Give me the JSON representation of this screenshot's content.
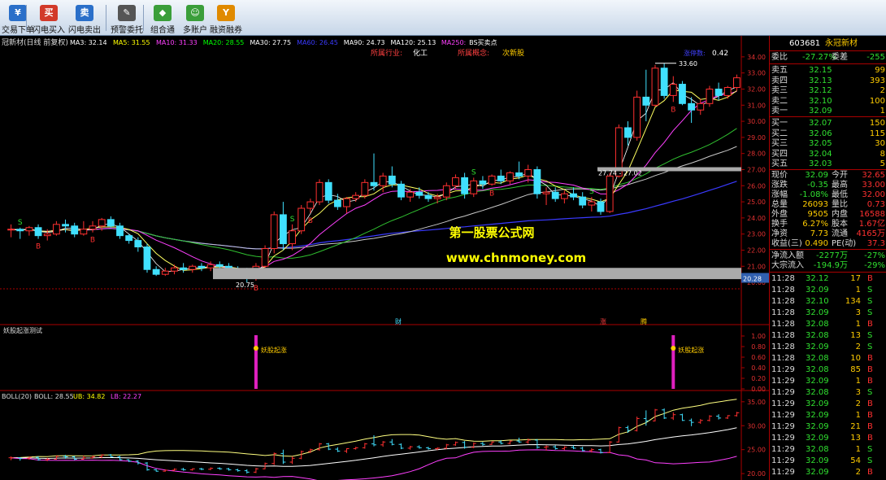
{
  "toolbar": {
    "items": [
      {
        "label": "交易下单",
        "glyph": "¥",
        "color": "#2a6fc9"
      },
      {
        "label": "闪电买入",
        "glyph": "买",
        "color": "#d23a2a"
      },
      {
        "label": "闪电卖出",
        "glyph": "卖",
        "color": "#2a6fc9"
      },
      {
        "label": "预警委托",
        "glyph": "✎",
        "color": "#555"
      },
      {
        "label": "组合通",
        "glyph": "◆",
        "color": "#3a9e3a"
      },
      {
        "label": "多账户",
        "glyph": "☺",
        "color": "#3a9e3a"
      },
      {
        "label": "融资融券",
        "glyph": "Y",
        "color": "#e08a00"
      }
    ]
  },
  "chart_data": {
    "type": "candlestick",
    "header": {
      "title": "冠新材(日线 前复权)",
      "indicators": [
        {
          "label": "MA3: 32.14",
          "color": "#ffffff"
        },
        {
          "label": "MA5: 31.55",
          "color": "#ffff00"
        },
        {
          "label": "MA10: 31.33",
          "color": "#ff40ff"
        },
        {
          "label": "MA20: 28.55",
          "color": "#00ff00"
        },
        {
          "label": "MA30: 27.75",
          "color": "#ffffff"
        },
        {
          "label": "MA60: 26.45",
          "color": "#3a3aff"
        },
        {
          "label": "MA90: 24.73",
          "color": "#ffffff"
        },
        {
          "label": "MA120: 25.13",
          "color": "#ffffff"
        },
        {
          "label": "MA250:",
          "color": "#ff40ff"
        },
        {
          "label": "BS买卖点",
          "color": "#ffffff"
        }
      ]
    },
    "industry_label": "所属行业:",
    "industry_value": "化工",
    "concept_label": "所属概念:",
    "concept_value": "次新股",
    "top_right": "涨停数:",
    "top_right_value": "0.42",
    "y_axis": [
      34.0,
      33.0,
      32.0,
      31.0,
      30.0,
      29.0,
      28.0,
      27.0,
      26.0,
      25.0,
      24.0,
      23.0,
      22.0,
      21.0,
      20.0
    ],
    "ylim": [
      19.6,
      34.6
    ],
    "y_tick_labels": [
      "34.00",
      "33.00",
      "32.00",
      "31.00",
      "30.00",
      "29.00",
      "28.00",
      "27.00",
      "26.00",
      "25.00",
      "24.00",
      "23.00",
      "22.00",
      "21.00",
      "20.00"
    ],
    "candles": [
      [
        23.3,
        23.6,
        22.8,
        23.3
      ],
      [
        23.3,
        23.4,
        22.7,
        23.2
      ],
      [
        23.2,
        23.5,
        22.9,
        23.4
      ],
      [
        23.4,
        23.6,
        22.7,
        22.9
      ],
      [
        22.9,
        23.3,
        22.6,
        23.0
      ],
      [
        23.0,
        23.8,
        22.9,
        23.6
      ],
      [
        23.6,
        23.9,
        23.1,
        23.5
      ],
      [
        23.5,
        23.7,
        22.8,
        23.0
      ],
      [
        23.0,
        23.8,
        22.9,
        23.3
      ],
      [
        23.3,
        23.8,
        23.1,
        23.5
      ],
      [
        23.5,
        24.0,
        23.2,
        23.9
      ],
      [
        23.9,
        24.1,
        23.4,
        23.5
      ],
      [
        23.5,
        23.7,
        22.7,
        22.9
      ],
      [
        22.9,
        23.0,
        22.4,
        22.6
      ],
      [
        22.6,
        22.8,
        21.9,
        22.2
      ],
      [
        22.2,
        22.4,
        20.6,
        20.8
      ],
      [
        20.8,
        21.0,
        20.4,
        20.5
      ],
      [
        20.5,
        20.9,
        20.4,
        20.7
      ],
      [
        20.7,
        21.1,
        20.5,
        20.9
      ],
      [
        20.9,
        21.2,
        20.6,
        20.8
      ],
      [
        20.8,
        21.1,
        20.6,
        21.0
      ],
      [
        21.0,
        21.2,
        20.7,
        20.9
      ],
      [
        20.9,
        21.3,
        20.7,
        21.1
      ],
      [
        21.1,
        21.3,
        20.8,
        21.0
      ],
      [
        21.0,
        21.2,
        20.6,
        20.8
      ],
      [
        20.8,
        21.0,
        20.4,
        20.6
      ],
      [
        20.6,
        20.9,
        20.0,
        20.3
      ],
      [
        20.3,
        21.2,
        20.1,
        21.0
      ],
      [
        21.0,
        22.3,
        20.9,
        22.1
      ],
      [
        22.1,
        24.4,
        21.8,
        24.2
      ],
      [
        24.2,
        25.0,
        22.0,
        22.4
      ],
      [
        22.4,
        23.6,
        22.0,
        23.2
      ],
      [
        23.2,
        24.8,
        23.0,
        24.6
      ],
      [
        24.6,
        25.2,
        24.3,
        25.0
      ],
      [
        25.0,
        26.4,
        24.8,
        26.2
      ],
      [
        26.2,
        26.4,
        24.9,
        25.1
      ],
      [
        25.1,
        25.5,
        24.5,
        24.7
      ],
      [
        24.7,
        25.3,
        24.3,
        25.2
      ],
      [
        25.2,
        25.6,
        25.0,
        25.4
      ],
      [
        25.4,
        26.4,
        25.2,
        26.2
      ],
      [
        26.2,
        28.0,
        25.7,
        26.0
      ],
      [
        26.0,
        26.8,
        25.6,
        26.6
      ],
      [
        26.6,
        27.2,
        25.9,
        26.1
      ],
      [
        26.1,
        26.3,
        25.1,
        25.3
      ],
      [
        25.3,
        25.8,
        25.0,
        25.6
      ],
      [
        25.6,
        25.9,
        25.2,
        25.4
      ],
      [
        25.4,
        25.6,
        25.0,
        25.2
      ],
      [
        25.2,
        25.5,
        24.9,
        25.3
      ],
      [
        25.3,
        26.2,
        25.1,
        26.0
      ],
      [
        26.0,
        26.7,
        25.8,
        26.5
      ],
      [
        26.5,
        26.8,
        25.2,
        25.5
      ],
      [
        25.5,
        26.5,
        25.3,
        26.3
      ],
      [
        26.3,
        26.6,
        25.8,
        26.1
      ],
      [
        26.1,
        26.7,
        26.0,
        26.6
      ],
      [
        26.6,
        27.0,
        26.1,
        26.3
      ],
      [
        26.3,
        26.9,
        26.1,
        26.8
      ],
      [
        26.8,
        27.5,
        26.4,
        26.6
      ],
      [
        26.6,
        27.3,
        26.2,
        27.0
      ],
      [
        27.0,
        27.2,
        25.2,
        25.5
      ],
      [
        25.5,
        25.9,
        24.8,
        25.6
      ],
      [
        25.6,
        25.9,
        25.0,
        25.2
      ],
      [
        25.2,
        25.7,
        24.9,
        25.5
      ],
      [
        25.5,
        25.9,
        25.1,
        25.3
      ],
      [
        25.3,
        25.6,
        24.6,
        24.8
      ],
      [
        24.8,
        25.3,
        24.4,
        25.0
      ],
      [
        25.0,
        25.2,
        24.2,
        24.4
      ],
      [
        24.4,
        26.8,
        24.3,
        26.6
      ],
      [
        26.6,
        29.8,
        26.5,
        29.6
      ],
      [
        29.6,
        30.0,
        28.5,
        29.0
      ],
      [
        29.0,
        31.9,
        28.8,
        31.5
      ],
      [
        31.5,
        33.2,
        30.0,
        31.0
      ],
      [
        31.0,
        33.5,
        30.9,
        33.3
      ],
      [
        33.3,
        33.6,
        31.4,
        31.6
      ],
      [
        31.6,
        32.8,
        31.2,
        32.3
      ],
      [
        32.3,
        32.5,
        31.0,
        31.1
      ],
      [
        31.1,
        31.5,
        29.9,
        30.7
      ],
      [
        30.7,
        31.4,
        30.4,
        31.1
      ],
      [
        31.1,
        32.2,
        30.9,
        32.0
      ],
      [
        32.0,
        32.4,
        31.3,
        31.6
      ],
      [
        31.6,
        32.2,
        31.4,
        32.1
      ],
      [
        32.1,
        32.9,
        31.9,
        32.7
      ]
    ],
    "ma_short_label": "MA5",
    "ma_mid_label": "MA10",
    "ma_long_label": "MA60",
    "annotations": [
      {
        "text": "33.60"
      },
      {
        "text": "20.75"
      },
      {
        "text": "27.74 - 27.02"
      },
      {
        "text": "20.28"
      }
    ],
    "signals": [
      {
        "i": 1,
        "t": "S"
      },
      {
        "i": 3,
        "t": "B"
      },
      {
        "i": 9,
        "t": "B"
      },
      {
        "i": 27,
        "t": "B"
      },
      {
        "i": 31,
        "t": "S"
      },
      {
        "i": 33,
        "t": "B"
      },
      {
        "i": 51,
        "t": "S"
      },
      {
        "i": 53,
        "t": "B"
      },
      {
        "i": 64,
        "t": "S"
      },
      {
        "i": 73,
        "t": "B"
      }
    ],
    "marks_between": {
      "left": "财",
      "mid": "涨",
      "right": "腾"
    },
    "sub1": {
      "title": "妖股起涨测试",
      "label": "妖股起涨",
      "y_ticks": [
        "1.00",
        "0.80",
        "0.60",
        "0.40",
        "0.20",
        "0.00"
      ],
      "signal_bars": [
        27,
        73
      ]
    },
    "sub2": {
      "title": "BOLL(20)",
      "boll": "BOLL: 28.55",
      "ub": "UB: 34.82",
      "lb": "LB: 22.27",
      "y_ticks": [
        "35.00",
        "30.00",
        "25.00",
        "20.00"
      ],
      "ylim": [
        19.0,
        36.5
      ]
    },
    "watermark": {
      "line1": "第一股票公式网",
      "line2": "www.chnmoney.com"
    }
  },
  "side": {
    "code": "603681",
    "name": "永冠新材",
    "wb": {
      "label": "委比",
      "value": "-27.27%",
      "label2": "委差",
      "value2": "-255"
    },
    "asks": [
      [
        "卖五",
        "32.15",
        "99"
      ],
      [
        "卖四",
        "32.13",
        "393"
      ],
      [
        "卖三",
        "32.12",
        "2"
      ],
      [
        "卖二",
        "32.10",
        "100"
      ],
      [
        "卖一",
        "32.09",
        "1"
      ]
    ],
    "bids": [
      [
        "买一",
        "32.07",
        "150"
      ],
      [
        "买二",
        "32.06",
        "115"
      ],
      [
        "买三",
        "32.05",
        "30"
      ],
      [
        "买四",
        "32.04",
        "8"
      ],
      [
        "买五",
        "32.03",
        "5"
      ]
    ],
    "stats": [
      [
        "现价",
        "32.09",
        "今开",
        "32.65"
      ],
      [
        "涨跌",
        "-0.35",
        "最高",
        "33.00"
      ],
      [
        "涨幅",
        "-1.08%",
        "最低",
        "32.00"
      ],
      [
        "总量",
        "26093",
        "量比",
        "0.73"
      ],
      [
        "外盘",
        "9505",
        "内盘",
        "16588"
      ],
      [
        "换手",
        "6.27%",
        "股本",
        "1.67亿"
      ],
      [
        "净资",
        "7.73",
        "流通",
        "4165万"
      ],
      [
        "收益(三)",
        "0.490",
        "PE(动)",
        "37.3"
      ]
    ],
    "flow": [
      [
        "净流入额",
        "-2277万",
        "-27%"
      ],
      [
        "大宗流入",
        "-194.9万",
        "-29%"
      ]
    ],
    "ticks": [
      [
        "11:28",
        "32.12",
        "17",
        "B"
      ],
      [
        "11:28",
        "32.09",
        "1",
        "S"
      ],
      [
        "11:28",
        "32.10",
        "134",
        "S"
      ],
      [
        "11:28",
        "32.09",
        "3",
        "S"
      ],
      [
        "11:28",
        "32.08",
        "1",
        "B"
      ],
      [
        "11:28",
        "32.08",
        "13",
        "S"
      ],
      [
        "11:28",
        "32.09",
        "2",
        "S"
      ],
      [
        "11:28",
        "32.08",
        "10",
        "B"
      ],
      [
        "11:29",
        "32.08",
        "85",
        "B"
      ],
      [
        "11:29",
        "32.09",
        "1",
        "B"
      ],
      [
        "11:29",
        "32.08",
        "3",
        "S"
      ],
      [
        "11:29",
        "32.09",
        "2",
        "B"
      ],
      [
        "11:29",
        "32.09",
        "1",
        "B"
      ],
      [
        "11:29",
        "32.09",
        "21",
        "B"
      ],
      [
        "11:29",
        "32.09",
        "13",
        "B"
      ],
      [
        "11:29",
        "32.08",
        "1",
        "S"
      ],
      [
        "11:29",
        "32.09",
        "54",
        "S"
      ],
      [
        "11:29",
        "32.09",
        "2",
        "B"
      ]
    ]
  }
}
